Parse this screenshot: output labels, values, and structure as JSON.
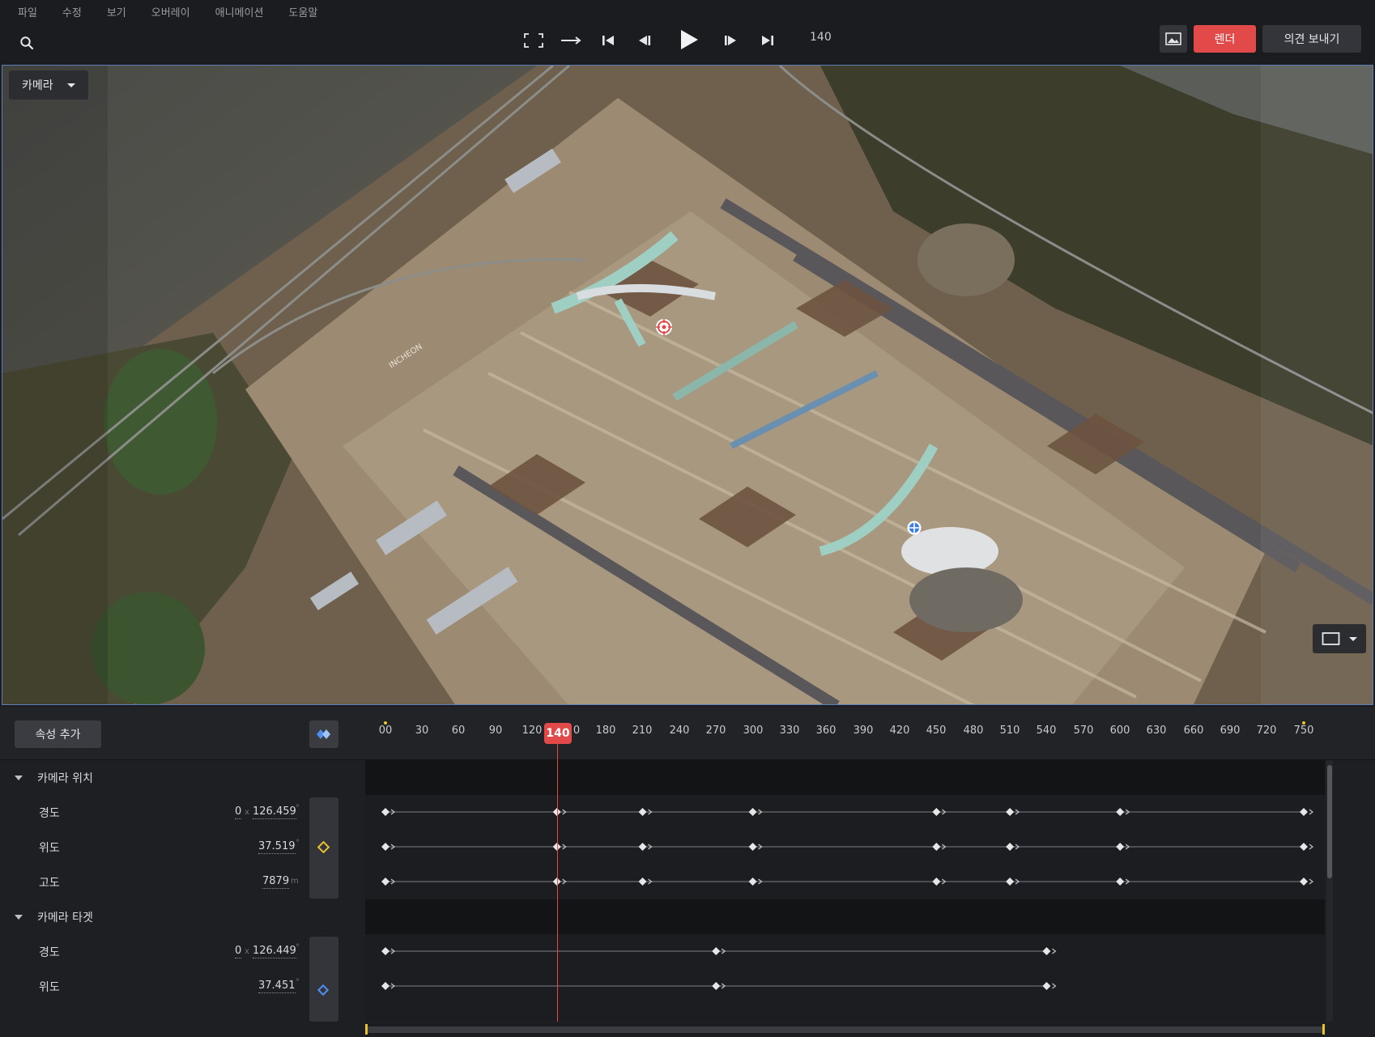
{
  "menu": [
    "파일",
    "수정",
    "보기",
    "오버레이",
    "애니메이션",
    "도움말"
  ],
  "toolbar": {
    "frame_value": "140",
    "render_label": "렌더",
    "feedback_label": "의견 보내기",
    "icons": [
      "search-icon",
      "fullscreen-icon",
      "loop-arrow-icon",
      "skip-start-icon",
      "step-back-icon",
      "play-icon",
      "step-forward-icon",
      "skip-end-icon",
      "image-icon"
    ]
  },
  "viewport": {
    "camera_dropdown_label": "카메라",
    "map_text": "INCHEON",
    "icons": [
      "camera-position-marker-icon",
      "camera-target-marker-icon",
      "aspect-ratio-icon"
    ]
  },
  "timeline": {
    "add_property_label": "속성 추가",
    "current_frame": "140",
    "ticks": [
      "00",
      "30",
      "60",
      "90",
      "120",
      "140",
      "0",
      "180",
      "210",
      "240",
      "270",
      "300",
      "330",
      "360",
      "390",
      "420",
      "450",
      "480",
      "510",
      "540",
      "570",
      "600",
      "630",
      "660",
      "690",
      "720",
      "750"
    ],
    "groups": [
      {
        "label": "카메라 위치",
        "properties": [
          {
            "label": "경도",
            "prefix": "0",
            "value": "126.459",
            "unit": "°"
          },
          {
            "label": "위도",
            "value": "37.519",
            "unit": "°"
          },
          {
            "label": "고도",
            "value": "7879",
            "unit": "m"
          }
        ]
      },
      {
        "label": "카메라 타겟",
        "properties": [
          {
            "label": "경도",
            "prefix": "0",
            "value": "126.449",
            "unit": "°"
          },
          {
            "label": "위도",
            "value": "37.451",
            "unit": "°"
          }
        ]
      }
    ],
    "keyframes_frames": {
      "pos_lon": [
        0,
        140,
        210,
        300,
        450,
        510,
        600,
        750
      ],
      "pos_lat": [
        0,
        140,
        210,
        300,
        450,
        510,
        600,
        750
      ],
      "pos_alt": [
        0,
        140,
        210,
        300,
        450,
        510,
        600,
        750
      ],
      "tgt_lon": [
        0,
        270,
        540
      ],
      "tgt_lat": [
        0,
        270,
        540
      ]
    },
    "colors": {
      "playhead": "#e24a4a",
      "keyframe": "#e6e6e6",
      "keyframe_yellow": "#e8c12c",
      "keyframe_blue": "#4f8ff0"
    }
  }
}
